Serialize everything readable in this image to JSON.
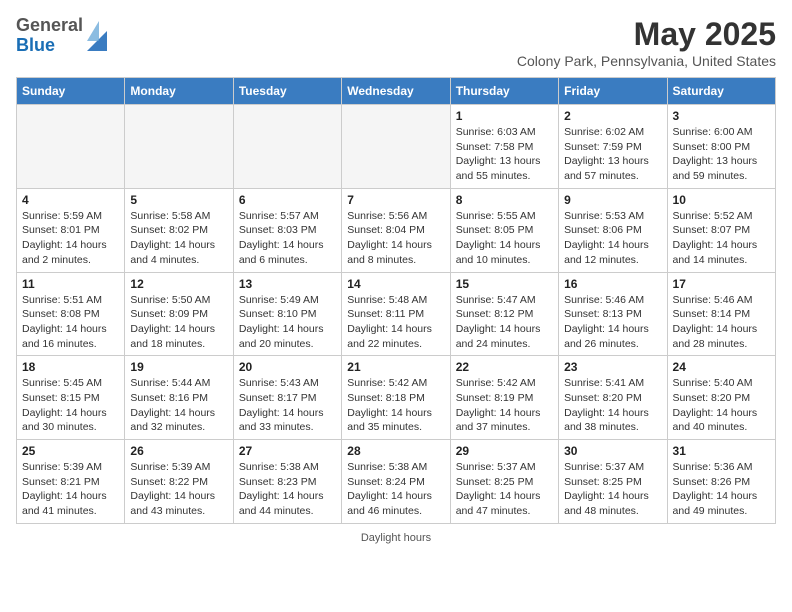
{
  "header": {
    "logo_general": "General",
    "logo_blue": "Blue",
    "main_title": "May 2025",
    "subtitle": "Colony Park, Pennsylvania, United States"
  },
  "days_of_week": [
    "Sunday",
    "Monday",
    "Tuesday",
    "Wednesday",
    "Thursday",
    "Friday",
    "Saturday"
  ],
  "weeks": [
    [
      {
        "day": "",
        "empty": true
      },
      {
        "day": "",
        "empty": true
      },
      {
        "day": "",
        "empty": true
      },
      {
        "day": "",
        "empty": true
      },
      {
        "day": "1",
        "sunrise": "6:03 AM",
        "sunset": "7:58 PM",
        "daylight": "13 hours and 55 minutes."
      },
      {
        "day": "2",
        "sunrise": "6:02 AM",
        "sunset": "7:59 PM",
        "daylight": "13 hours and 57 minutes."
      },
      {
        "day": "3",
        "sunrise": "6:00 AM",
        "sunset": "8:00 PM",
        "daylight": "13 hours and 59 minutes."
      }
    ],
    [
      {
        "day": "4",
        "sunrise": "5:59 AM",
        "sunset": "8:01 PM",
        "daylight": "14 hours and 2 minutes."
      },
      {
        "day": "5",
        "sunrise": "5:58 AM",
        "sunset": "8:02 PM",
        "daylight": "14 hours and 4 minutes."
      },
      {
        "day": "6",
        "sunrise": "5:57 AM",
        "sunset": "8:03 PM",
        "daylight": "14 hours and 6 minutes."
      },
      {
        "day": "7",
        "sunrise": "5:56 AM",
        "sunset": "8:04 PM",
        "daylight": "14 hours and 8 minutes."
      },
      {
        "day": "8",
        "sunrise": "5:55 AM",
        "sunset": "8:05 PM",
        "daylight": "14 hours and 10 minutes."
      },
      {
        "day": "9",
        "sunrise": "5:53 AM",
        "sunset": "8:06 PM",
        "daylight": "14 hours and 12 minutes."
      },
      {
        "day": "10",
        "sunrise": "5:52 AM",
        "sunset": "8:07 PM",
        "daylight": "14 hours and 14 minutes."
      }
    ],
    [
      {
        "day": "11",
        "sunrise": "5:51 AM",
        "sunset": "8:08 PM",
        "daylight": "14 hours and 16 minutes."
      },
      {
        "day": "12",
        "sunrise": "5:50 AM",
        "sunset": "8:09 PM",
        "daylight": "14 hours and 18 minutes."
      },
      {
        "day": "13",
        "sunrise": "5:49 AM",
        "sunset": "8:10 PM",
        "daylight": "14 hours and 20 minutes."
      },
      {
        "day": "14",
        "sunrise": "5:48 AM",
        "sunset": "8:11 PM",
        "daylight": "14 hours and 22 minutes."
      },
      {
        "day": "15",
        "sunrise": "5:47 AM",
        "sunset": "8:12 PM",
        "daylight": "14 hours and 24 minutes."
      },
      {
        "day": "16",
        "sunrise": "5:46 AM",
        "sunset": "8:13 PM",
        "daylight": "14 hours and 26 minutes."
      },
      {
        "day": "17",
        "sunrise": "5:46 AM",
        "sunset": "8:14 PM",
        "daylight": "14 hours and 28 minutes."
      }
    ],
    [
      {
        "day": "18",
        "sunrise": "5:45 AM",
        "sunset": "8:15 PM",
        "daylight": "14 hours and 30 minutes."
      },
      {
        "day": "19",
        "sunrise": "5:44 AM",
        "sunset": "8:16 PM",
        "daylight": "14 hours and 32 minutes."
      },
      {
        "day": "20",
        "sunrise": "5:43 AM",
        "sunset": "8:17 PM",
        "daylight": "14 hours and 33 minutes."
      },
      {
        "day": "21",
        "sunrise": "5:42 AM",
        "sunset": "8:18 PM",
        "daylight": "14 hours and 35 minutes."
      },
      {
        "day": "22",
        "sunrise": "5:42 AM",
        "sunset": "8:19 PM",
        "daylight": "14 hours and 37 minutes."
      },
      {
        "day": "23",
        "sunrise": "5:41 AM",
        "sunset": "8:20 PM",
        "daylight": "14 hours and 38 minutes."
      },
      {
        "day": "24",
        "sunrise": "5:40 AM",
        "sunset": "8:20 PM",
        "daylight": "14 hours and 40 minutes."
      }
    ],
    [
      {
        "day": "25",
        "sunrise": "5:39 AM",
        "sunset": "8:21 PM",
        "daylight": "14 hours and 41 minutes."
      },
      {
        "day": "26",
        "sunrise": "5:39 AM",
        "sunset": "8:22 PM",
        "daylight": "14 hours and 43 minutes."
      },
      {
        "day": "27",
        "sunrise": "5:38 AM",
        "sunset": "8:23 PM",
        "daylight": "14 hours and 44 minutes."
      },
      {
        "day": "28",
        "sunrise": "5:38 AM",
        "sunset": "8:24 PM",
        "daylight": "14 hours and 46 minutes."
      },
      {
        "day": "29",
        "sunrise": "5:37 AM",
        "sunset": "8:25 PM",
        "daylight": "14 hours and 47 minutes."
      },
      {
        "day": "30",
        "sunrise": "5:37 AM",
        "sunset": "8:25 PM",
        "daylight": "14 hours and 48 minutes."
      },
      {
        "day": "31",
        "sunrise": "5:36 AM",
        "sunset": "8:26 PM",
        "daylight": "14 hours and 49 minutes."
      }
    ]
  ],
  "footer": {
    "note": "Daylight hours"
  }
}
